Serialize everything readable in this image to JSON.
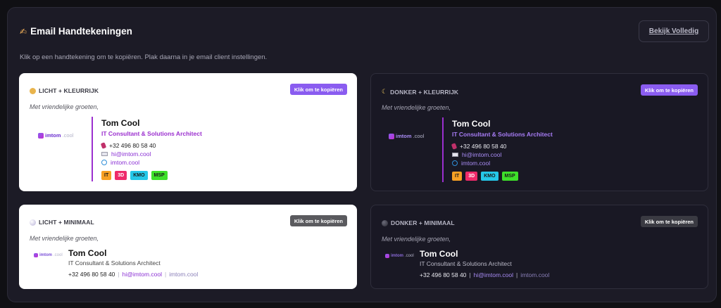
{
  "header": {
    "icon": "writing-hand-icon",
    "title": "Email Handtekeningen",
    "view_all": "Bekijk Volledig",
    "subtitle": "Klik op een handtekening om te kopiëren. Plak daarna in je email client instellingen."
  },
  "signature": {
    "greeting": "Met vriendelijke groeten,",
    "name": "Tom Cool",
    "role": "IT Consultant & Solutions Architect",
    "phone": "+32 496 80 58 40",
    "email": "hi@imtom.cool",
    "website": "imtom.cool",
    "logo_text": "imtom",
    "logo_suffix": ".cool",
    "separator": "|",
    "tags": [
      "IT",
      "3D",
      "KMO",
      "MSP"
    ]
  },
  "cards": [
    {
      "label": "LICHT + KLEURRIJK",
      "icon": "palette-icon",
      "copy": "Klik om te kopiëren"
    },
    {
      "label": "DONKER + KLEURRIJK",
      "icon": "moon-icon",
      "copy": "Klik om te kopiëren"
    },
    {
      "label": "LICHT + MINIMAAL",
      "icon": "light-circle-icon",
      "copy": "Klik om te kopiëren"
    },
    {
      "label": "DONKER + MINIMAAL",
      "icon": "dark-circle-icon",
      "copy": "Klik om te kopiëren"
    }
  ],
  "colors": {
    "accent": "#8a5cf0",
    "brand_purple": "#9b2fcf",
    "background": "#1c1b26"
  }
}
